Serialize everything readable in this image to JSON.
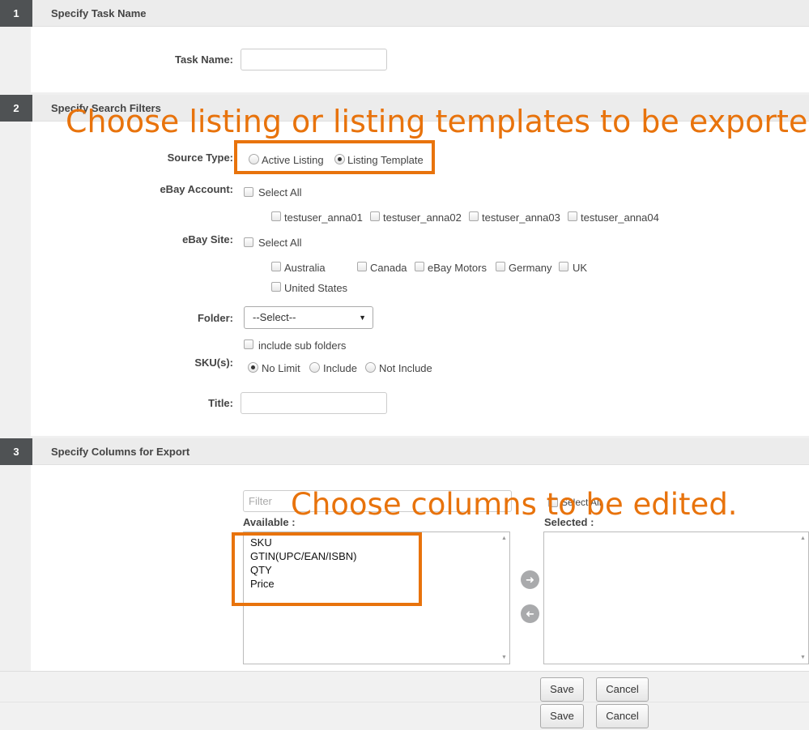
{
  "sections": [
    {
      "num": "1",
      "title": "Specify Task Name"
    },
    {
      "num": "2",
      "title": "Specify Search Filters"
    },
    {
      "num": "3",
      "title": "Specify Columns for Export"
    }
  ],
  "task": {
    "label": "Task Name:",
    "value": ""
  },
  "filters": {
    "source_type": {
      "label": "Source Type:",
      "options": [
        "Active Listing",
        "Listing Template"
      ],
      "selected": "Listing Template"
    },
    "ebay_account": {
      "label": "eBay Account:",
      "select_all": "Select All",
      "accounts": [
        "testuser_anna01",
        "testuser_anna02",
        "testuser_anna03",
        "testuser_anna04"
      ]
    },
    "ebay_site": {
      "label": "eBay Site:",
      "select_all": "Select All",
      "sites": [
        "Australia",
        "Canada",
        "eBay Motors",
        "Germany",
        "UK",
        "United States"
      ]
    },
    "folder": {
      "label": "Folder:",
      "value": "--Select--",
      "include_sub": "include sub folders"
    },
    "skus": {
      "label": "SKU(s):",
      "options": [
        "No Limit",
        "Include",
        "Not Include"
      ],
      "selected": "No Limit"
    },
    "title": {
      "label": "Title:",
      "value": ""
    }
  },
  "columns": {
    "filter_placeholder": "Filter",
    "select_all": "Select All",
    "available_label": "Available :",
    "selected_label": "Selected :",
    "available": [
      "SKU",
      "GTIN(UPC/EAN/ISBN)",
      "QTY",
      "Price"
    ],
    "selected": []
  },
  "actions": {
    "save": "Save",
    "cancel": "Cancel"
  },
  "annotations": {
    "callout1": "Choose listing or listing templates to be exported.",
    "callout2": "Choose columns to be edited.",
    "color": "#e8730c"
  }
}
